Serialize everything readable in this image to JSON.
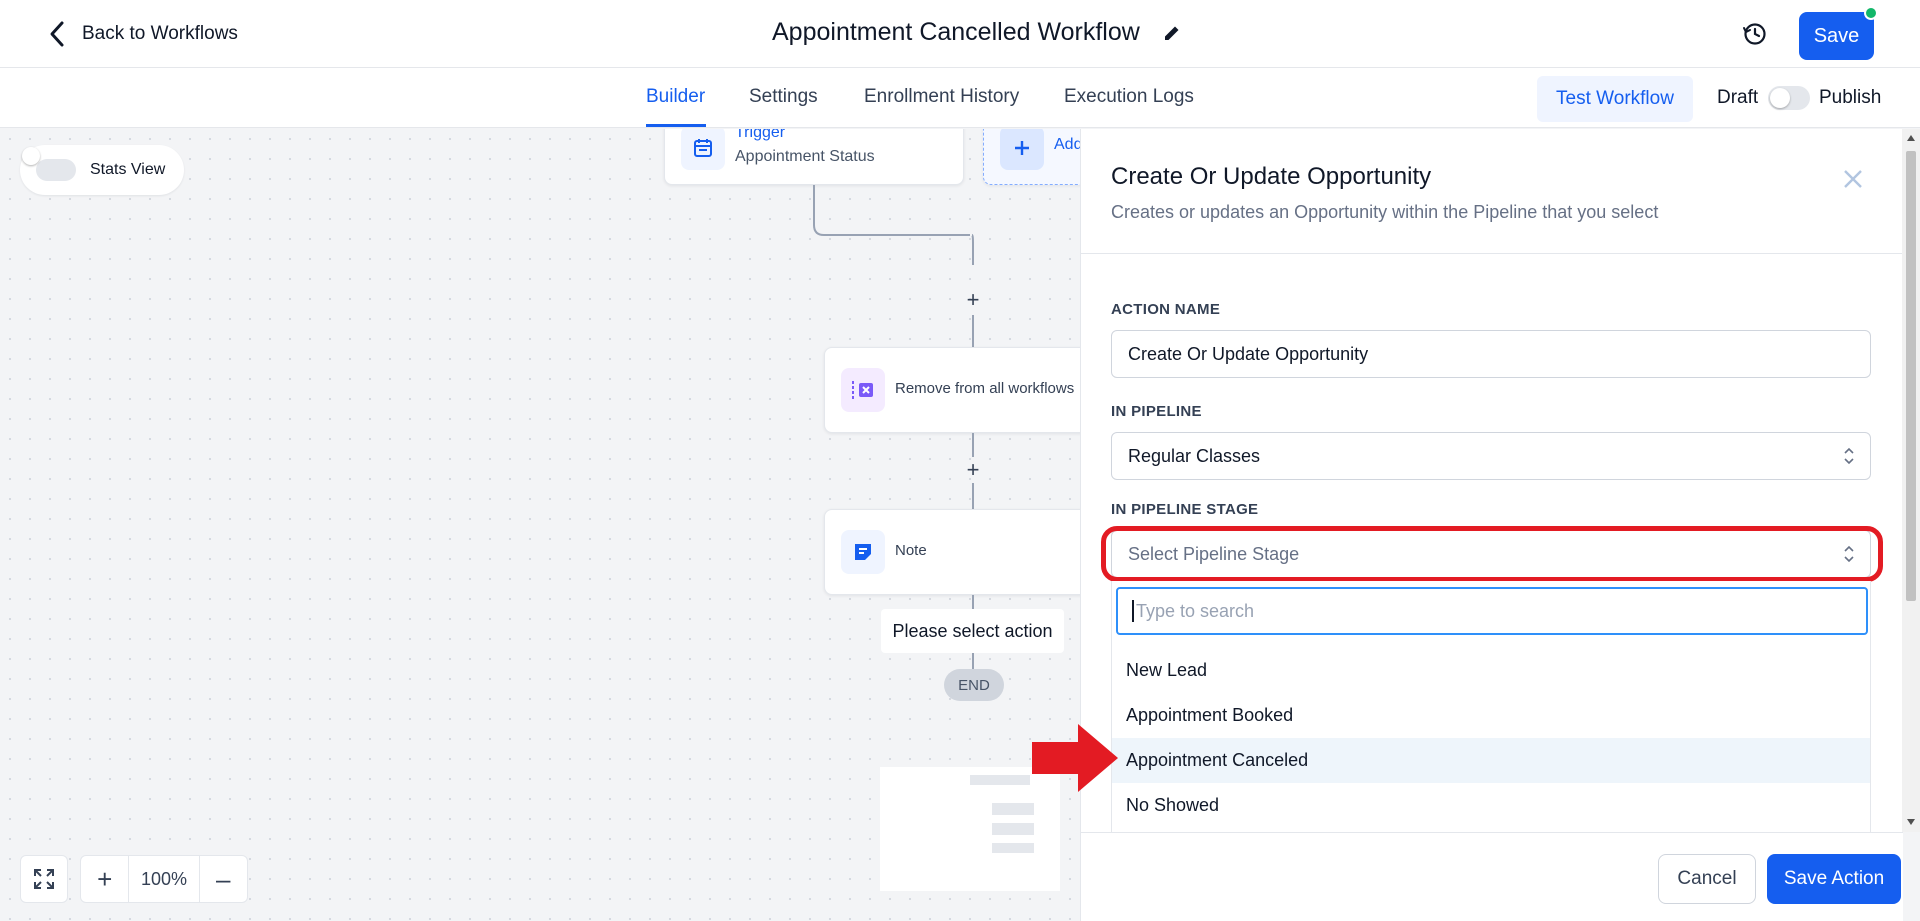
{
  "header": {
    "back_label": "Back to Workflows",
    "workflow_title": "Appointment Cancelled Workflow",
    "save_label": "Save"
  },
  "tabs": [
    {
      "label": "Builder",
      "active": true
    },
    {
      "label": "Settings",
      "active": false
    },
    {
      "label": "Enrollment History",
      "active": false
    },
    {
      "label": "Execution Logs",
      "active": false
    }
  ],
  "toolbar": {
    "test_workflow_label": "Test Workflow",
    "draft_label": "Draft",
    "publish_label": "Publish"
  },
  "canvas": {
    "stats_view_label": "Stats View",
    "trigger_title": "Trigger",
    "trigger_subtitle": "Appointment Status",
    "add_trigger_label": "Add",
    "remove_node_label": "Remove from all workflows",
    "note_node_label": "Note",
    "please_select_label": "Please select action",
    "end_label": "END",
    "zoom_level": "100%"
  },
  "panel": {
    "title": "Create Or Update Opportunity",
    "subtitle": "Creates or updates an Opportunity within the Pipeline that you select",
    "action_name_label": "ACTION NAME",
    "action_name_value": "Create Or Update Opportunity",
    "pipeline_label": "IN PIPELINE",
    "pipeline_value": "Regular Classes",
    "stage_label": "IN PIPELINE STAGE",
    "stage_placeholder": "Select Pipeline Stage",
    "search_placeholder": "Type to search",
    "stage_options": [
      "New Lead",
      "Appointment Booked",
      "Appointment Canceled",
      "No Showed"
    ],
    "highlighted_option": "Appointment Canceled",
    "cancel_label": "Cancel",
    "save_action_label": "Save Action"
  },
  "colors": {
    "primary": "#155eef",
    "highlight_border": "#e31b23",
    "status_dot": "#12b76a"
  }
}
